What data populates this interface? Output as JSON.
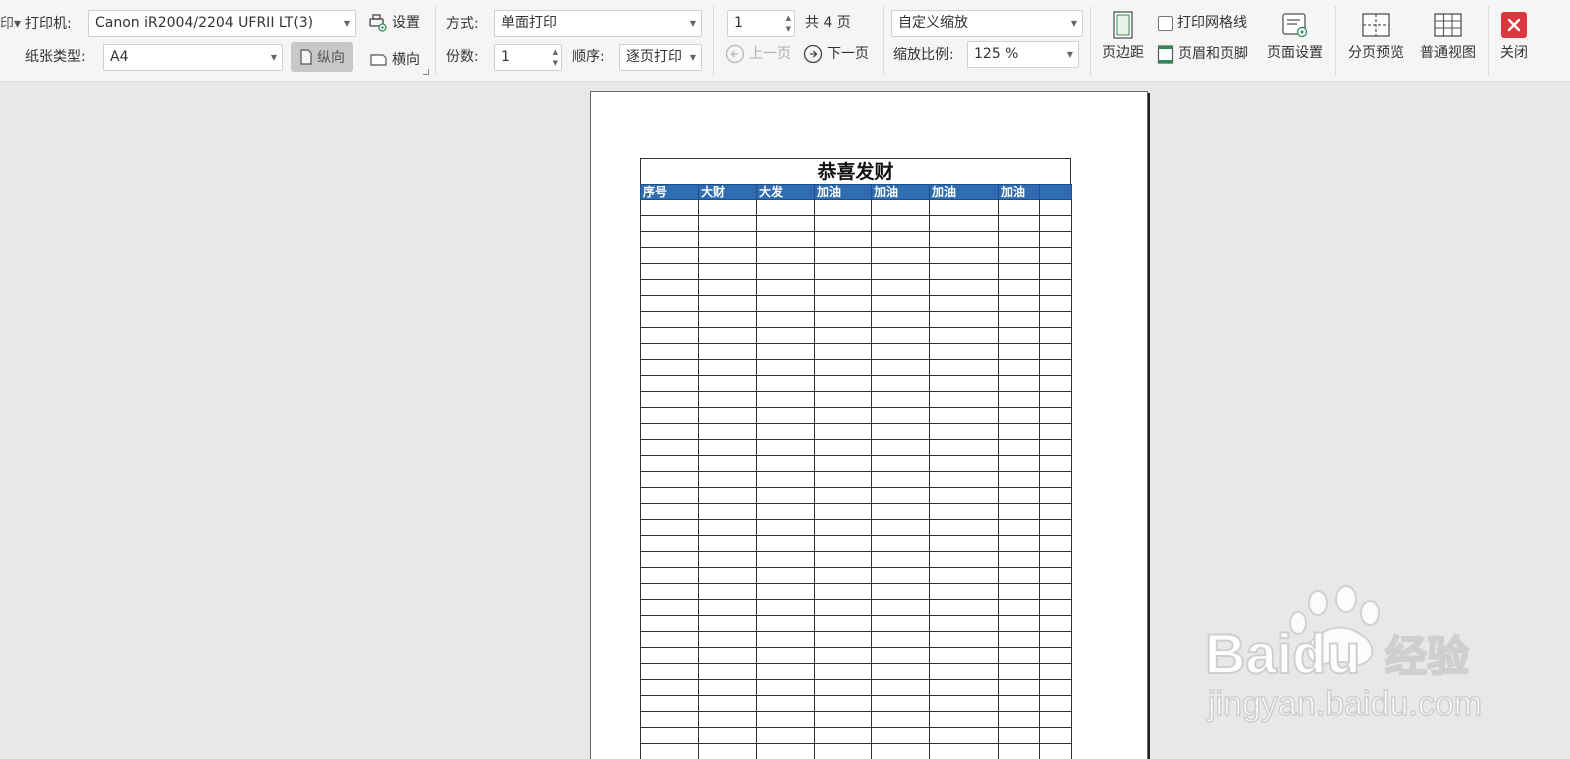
{
  "toolbar": {
    "printer_label": "打印机:",
    "printer_value": "Canon iR2004/2204 UFRII LT(3)",
    "settings_label": "设置",
    "paper_type_label": "纸张类型:",
    "paper_type_value": "A4",
    "portrait_label": "纵向",
    "landscape_label": "横向",
    "mode_label": "方式:",
    "mode_value": "单面打印",
    "copies_label": "份数:",
    "copies_value": "1",
    "order_label": "顺序:",
    "order_value": "逐页打印",
    "page_input_value": "1",
    "total_pages_label": "共 4 页",
    "prev_page_label": "上一页",
    "next_page_label": "下一页",
    "scale_mode_value": "自定义缩放",
    "scale_ratio_label": "缩放比例:",
    "scale_ratio_value": "125 %",
    "margins_label": "页边距",
    "print_gridlines_label": "打印网格线",
    "header_footer_label": "页眉和页脚",
    "page_setup_label": "页面设置",
    "page_break_preview_label": "分页预览",
    "normal_view_label": "普通视图",
    "close_label": "关闭"
  },
  "sheet": {
    "title": "恭喜发财",
    "headers": [
      "序号",
      "大财",
      "大发",
      "加油",
      "加油",
      "加油",
      "加油",
      ""
    ]
  },
  "watermark": {
    "brand": "Baidu",
    "brand_cn": "经验",
    "url": "jingyan.baidu.com"
  },
  "colors": {
    "header_blue": "#2f6db2",
    "close_red": "#d9393e"
  }
}
